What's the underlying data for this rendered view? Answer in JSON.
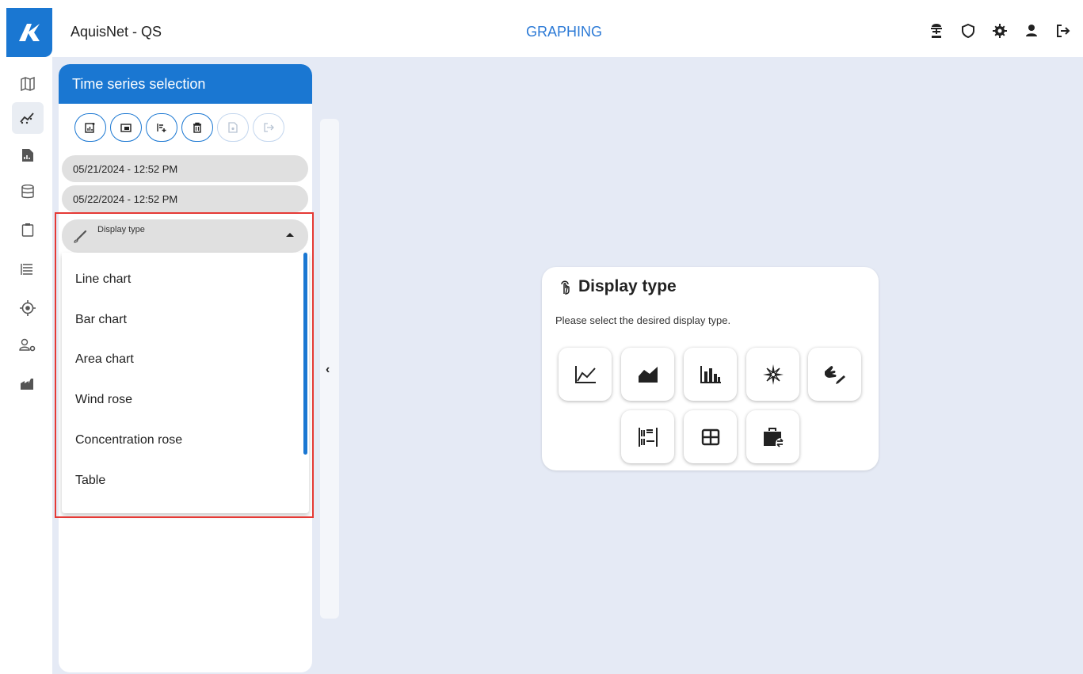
{
  "app": {
    "title": "AquisNet - QS",
    "page_label": "GRAPHING"
  },
  "top_icons": [
    "weather-station-icon",
    "shield-icon",
    "gear-icon",
    "user-icon",
    "logout-icon"
  ],
  "nav_icons": [
    "map-icon",
    "graph-icon",
    "report-icon",
    "database-icon",
    "clipboard-icon",
    "list-icon",
    "target-icon",
    "user-settings-icon",
    "factory-icon"
  ],
  "colors": {
    "accent": "#1a77d2",
    "background": "#e5eaf5",
    "highlight": "#e53935"
  },
  "time_series": {
    "title": "Time series selection",
    "start_date": "05/21/2024 - 12:52 PM",
    "end_date": "05/22/2024 - 12:52 PM",
    "display_type_label": "Display type",
    "options": [
      "Line chart",
      "Bar chart",
      "Area chart",
      "Wind rose",
      "Concentration rose",
      "Table"
    ]
  },
  "card": {
    "title": "Display type",
    "subtitle": "Please select the desired display type."
  }
}
